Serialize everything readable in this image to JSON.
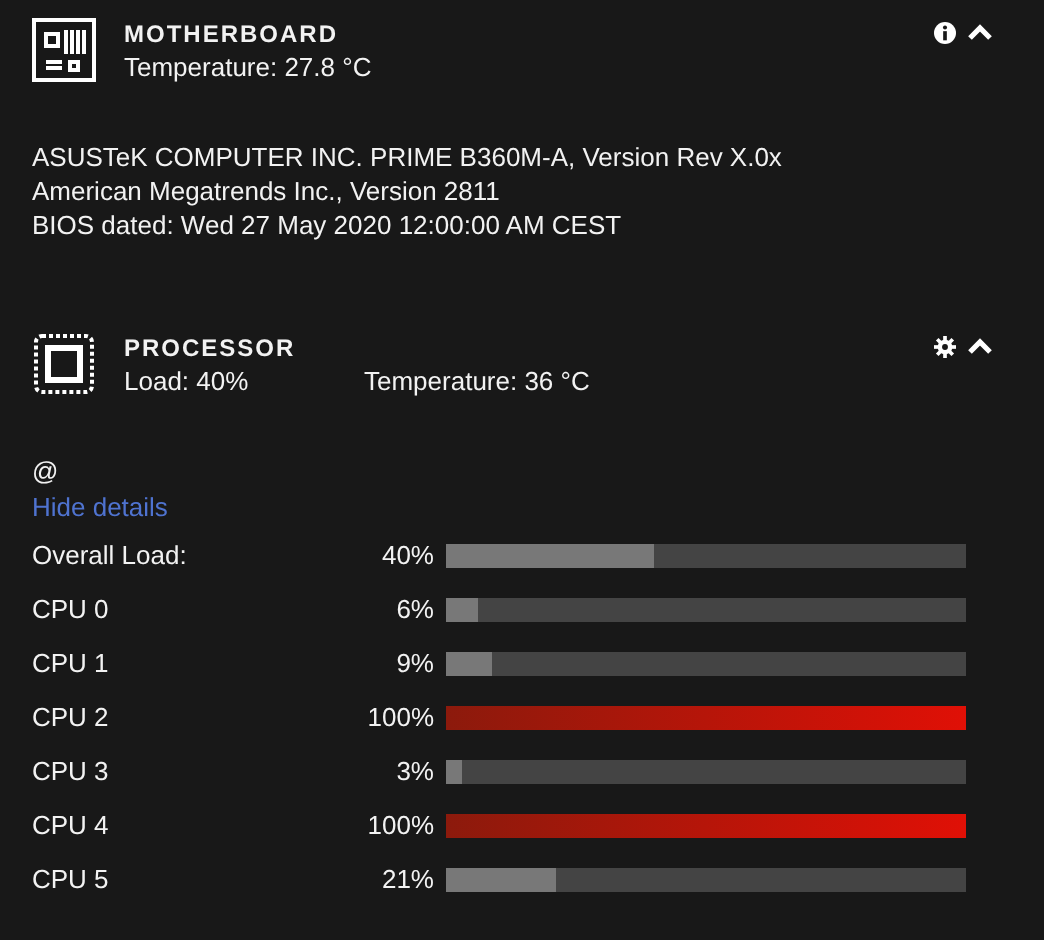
{
  "motherboard": {
    "title": "MOTHERBOARD",
    "temperature": "Temperature: 27.8 °C",
    "expanded": true,
    "details": [
      "ASUSTeK COMPUTER INC. PRIME B360M-A, Version Rev X.0x",
      "American Megatrends Inc., Version 2811",
      "BIOS dated: Wed 27 May 2020 12:00:00 AM CEST"
    ]
  },
  "processor": {
    "title": "PROCESSOR",
    "load": "Load: 40%",
    "temperature": "Temperature: 36 °C",
    "expanded": true,
    "name": "@",
    "toggle_link": "Hide details",
    "rows": [
      {
        "label": "Overall Load:",
        "reading": "40%",
        "level": 0.4
      },
      {
        "label": "CPU 0",
        "reading": "6%",
        "level": 0.06
      },
      {
        "label": "CPU 1",
        "reading": "9%",
        "level": 0.09
      },
      {
        "label": "CPU 2",
        "reading": "100%",
        "level": 1.0
      },
      {
        "label": "CPU 3",
        "reading": "3%",
        "level": 0.03
      },
      {
        "label": "CPU 4",
        "reading": "100%",
        "level": 1.0
      },
      {
        "label": "CPU 5",
        "reading": "21%",
        "level": 0.21
      }
    ]
  }
}
